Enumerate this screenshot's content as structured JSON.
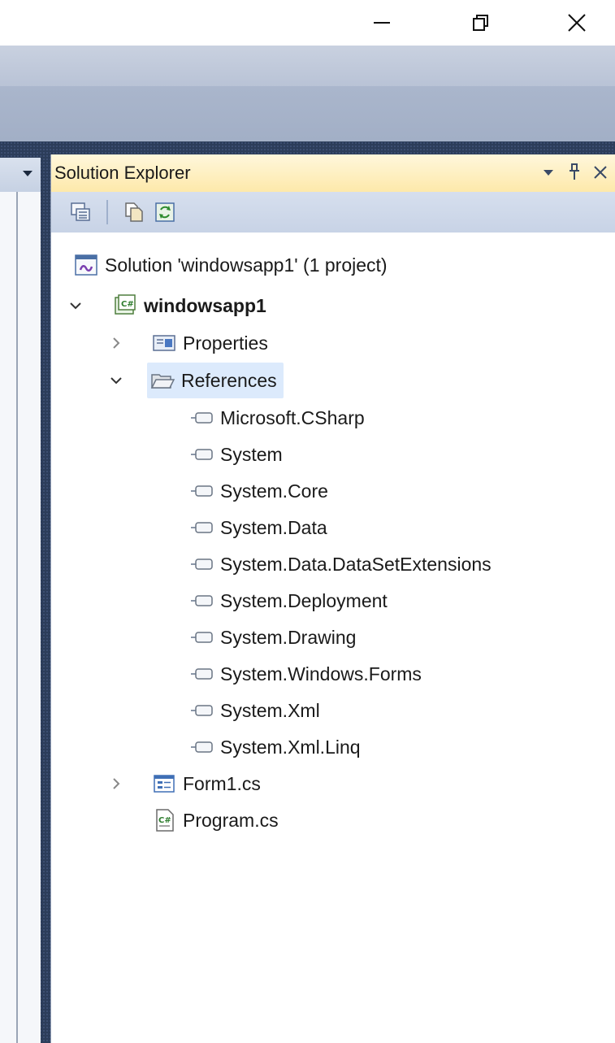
{
  "window": {
    "controls": [
      "minimize-icon",
      "restore-icon",
      "close-icon"
    ]
  },
  "solution_explorer": {
    "title": "Solution Explorer",
    "header_buttons": [
      "dropdown-icon",
      "pin-icon",
      "close-icon"
    ],
    "toolbar": [
      "properties-icon",
      "show-all-files-icon",
      "refresh-icon"
    ],
    "tree": {
      "solution": "Solution 'windowsapp1' (1 project)",
      "project": "windowsapp1",
      "properties": "Properties",
      "references": {
        "label": "References",
        "items": [
          "Microsoft.CSharp",
          "System",
          "System.Core",
          "System.Data",
          "System.Data.DataSetExtensions",
          "System.Deployment",
          "System.Drawing",
          "System.Windows.Forms",
          "System.Xml",
          "System.Xml.Linq"
        ]
      },
      "form1": "Form1.cs",
      "program": "Program.cs"
    }
  },
  "colors": {
    "header_gold": "#fde9aa",
    "toolbar_blue": "#c8d3e6",
    "workspace_dark": "#2c3d5a",
    "selection": "#dceafc"
  }
}
